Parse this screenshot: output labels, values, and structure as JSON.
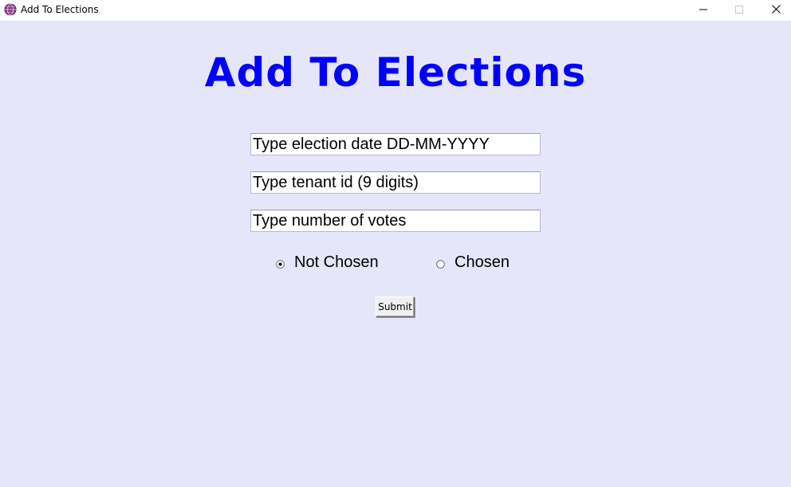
{
  "window": {
    "title": "Add To Elections",
    "controls": {
      "minimize_icon": "minimize-icon",
      "maximize_icon": "maximize-icon",
      "close_icon": "close-icon"
    }
  },
  "heading": {
    "text": "Add To Elections",
    "color": "#0000ff"
  },
  "form": {
    "election_date": {
      "placeholder": "Type election date DD-MM-YYYY",
      "value": ""
    },
    "tenant_id": {
      "placeholder": "Type tenant id (9 digits)",
      "value": ""
    },
    "votes": {
      "placeholder": "Type number of votes",
      "value": ""
    },
    "status": {
      "options": [
        {
          "label": "Not Chosen",
          "selected": true
        },
        {
          "label": "Chosen",
          "selected": false
        }
      ]
    },
    "submit_label": "Submit"
  },
  "colors": {
    "background": "#e6e6fa",
    "heading": "#0000ff"
  }
}
